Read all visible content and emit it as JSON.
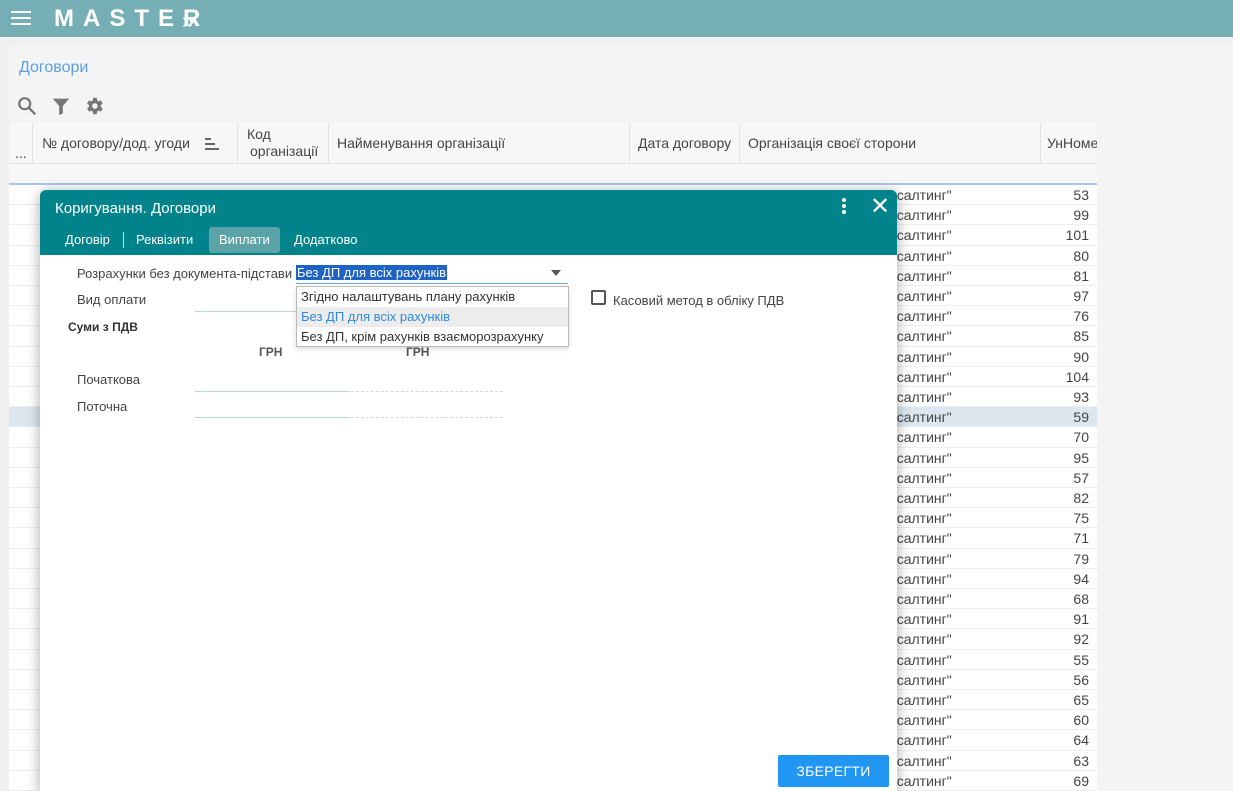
{
  "app": {
    "brand": "MASTER",
    "brand_arrow": "»"
  },
  "page": {
    "title": "Договори"
  },
  "grid": {
    "columns": [
      {
        "label": "..."
      },
      {
        "label": "№ договору/дод. угоди"
      },
      {
        "label_line1": "Код",
        "label_line2": "організації"
      },
      {
        "label": "Найменування організації"
      },
      {
        "label": "Дата договору"
      },
      {
        "label": "Організація своєї сторони"
      },
      {
        "label": "УнНоме"
      }
    ],
    "row_org_text": "нсалтинг\"",
    "rows": [
      "53",
      "99",
      "101",
      "80",
      "81",
      "97",
      "76",
      "85",
      "90",
      "104",
      "93",
      "59",
      "70",
      "95",
      "57",
      "82",
      "75",
      "71",
      "79",
      "94",
      "68",
      "91",
      "92",
      "55",
      "56",
      "65",
      "60",
      "64",
      "63",
      "69"
    ],
    "selected_row_index": 11
  },
  "dialog": {
    "title": "Коригування. Договори",
    "close_glyph": "✕",
    "tabs": [
      "Договір",
      "Реквізити",
      "Виплати",
      "Додатково"
    ],
    "active_tab": "Виплати",
    "fields": {
      "settlements_label": "Розрахунки без документа-підстави",
      "settlements_value": "Без ДП для всіх рахунків",
      "payment_type_label": "Вид оплати",
      "vat_sums_label": "Суми з ПДВ",
      "currency_col1": "ГРН",
      "currency_col2": "ГРН",
      "initial_label": "Початкова",
      "current_label": "Поточна",
      "cash_method_label": "Касовий метод в обліку ПДВ"
    },
    "dropdown_options": [
      "Згідно налаштувань плану рахунків",
      "Без ДП для всіх рахунків",
      "Без ДП, крім рахунків взаєморозрахунку"
    ],
    "dropdown_selected_index": 1,
    "save_label": "ЗБЕРЕГТИ"
  },
  "colors": {
    "topbar": "#75aeb4",
    "dialog_header": "#00838a",
    "accent": "#2196f3",
    "title_blue": "#5aa0e4"
  },
  "icons": [
    "menu-icon",
    "search-icon",
    "filter-icon",
    "gear-icon",
    "sort-icon",
    "more-vert-icon",
    "close-icon"
  ]
}
